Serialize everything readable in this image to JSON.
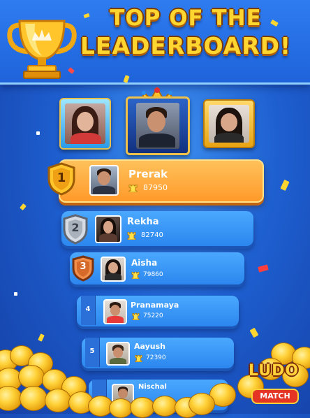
{
  "header": {
    "title_line1": "TOP OF THE",
    "title_line2": "LEADERBOARD!",
    "trophy_icon": "trophy-crown-icon"
  },
  "colors": {
    "background": "#1e5fd0",
    "title_gold": "#ffd630",
    "first_row": "#ffa83a",
    "row_blue": "#3a97fa"
  },
  "podium": [
    {
      "position": "left",
      "frame": "blue-gold"
    },
    {
      "position": "center",
      "frame": "royal-crown"
    },
    {
      "position": "right",
      "frame": "gold"
    }
  ],
  "leaderboard": [
    {
      "rank": "1",
      "name": "Prerak",
      "score": "87950",
      "badge": "gold-shield"
    },
    {
      "rank": "2",
      "name": "Rekha",
      "score": "82740",
      "badge": "silver-shield"
    },
    {
      "rank": "3",
      "name": "Aisha",
      "score": "79860",
      "badge": "bronze-shield"
    },
    {
      "rank": "4",
      "name": "Pranamaya",
      "score": "75220",
      "badge": "ribbon"
    },
    {
      "rank": "5",
      "name": "Aayush",
      "score": "72390",
      "badge": "ribbon"
    },
    {
      "rank": "",
      "name": "Nischal",
      "score": "",
      "badge": "ribbon"
    }
  ],
  "score_icon": "castle-rook-icon",
  "logo": {
    "line1": "LUDO",
    "line2": "MATCH"
  }
}
